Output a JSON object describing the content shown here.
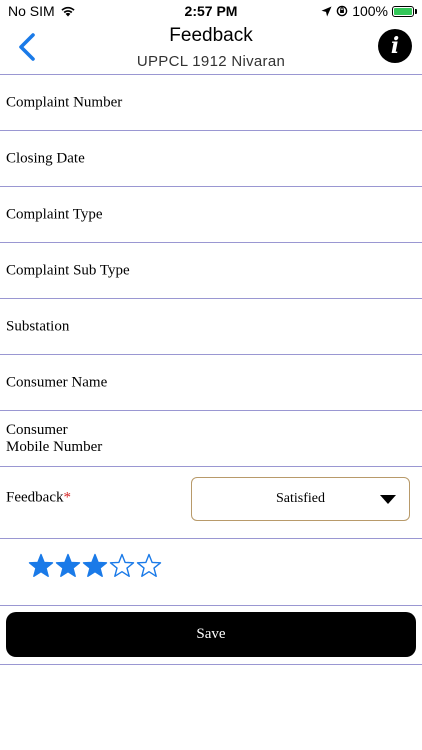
{
  "status_bar": {
    "carrier": "No SIM",
    "time": "2:57 PM",
    "battery": "100%",
    "battery_level": 1.0,
    "icons": [
      "wifi-icon",
      "location-arrow-icon",
      "orientation-lock-icon",
      "battery-charging-icon"
    ]
  },
  "nav": {
    "title": "Feedback",
    "subtitle": "UPPCL 1912 Nivaran",
    "back_icon": "chevron-left-icon",
    "info_icon": "info-icon",
    "info_glyph": "i"
  },
  "form": {
    "fields": [
      {
        "label": "Complaint Number",
        "value": ""
      },
      {
        "label": "Closing Date",
        "value": ""
      },
      {
        "label": "Complaint Type",
        "value": ""
      },
      {
        "label": "Complaint Sub Type",
        "value": ""
      },
      {
        "label": "Substation",
        "value": ""
      },
      {
        "label": "Consumer Name",
        "value": ""
      },
      {
        "label_line1": "Consumer",
        "label_line2": "Mobile Number",
        "value": ""
      }
    ],
    "feedback": {
      "label": "Feedback",
      "required_mark": "*",
      "selected_value": "Satisfied"
    },
    "rating": {
      "value": 3,
      "max": 5,
      "filled_color": "#1a7ae8",
      "empty_color": "#1a7ae8"
    },
    "save_label": "Save"
  },
  "colors": {
    "accent": "#1a7ae8",
    "divider": "#9a97d2",
    "dropdown_border": "#b89a6a",
    "required": "#d62a2a"
  }
}
